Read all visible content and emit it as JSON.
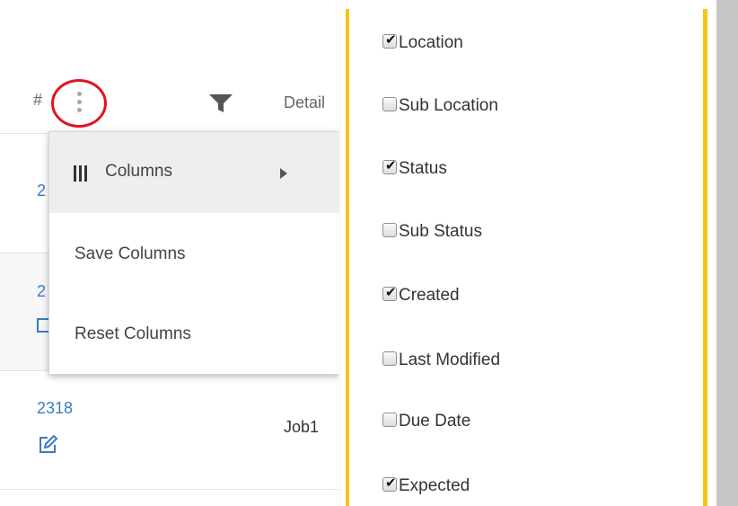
{
  "table": {
    "header": {
      "hash": "#",
      "detail": "Detail"
    },
    "rows": [
      {
        "id": "2",
        "job": ""
      },
      {
        "id": "2",
        "job": ""
      },
      {
        "id": "2318",
        "job": "Job1"
      }
    ]
  },
  "menu": {
    "items": [
      {
        "label": "Columns",
        "icon": "columns-icon",
        "has_submenu": true
      },
      {
        "label": "Save Columns"
      },
      {
        "label": "Reset Columns"
      }
    ]
  },
  "column_picker": {
    "options": [
      {
        "label": "Location",
        "checked": true
      },
      {
        "label": "Sub Location",
        "checked": false
      },
      {
        "label": "Status",
        "checked": true
      },
      {
        "label": "Sub Status",
        "checked": false
      },
      {
        "label": "Created",
        "checked": true
      },
      {
        "label": "Last Modified",
        "checked": false
      },
      {
        "label": "Due Date",
        "checked": false
      },
      {
        "label": "Expected",
        "checked": true
      }
    ]
  },
  "colors": {
    "link": "#3a7cc3",
    "highlight_ring": "#e0141e",
    "panel_border": "#f4c518",
    "menu_active_bg": "#eeeeee"
  }
}
